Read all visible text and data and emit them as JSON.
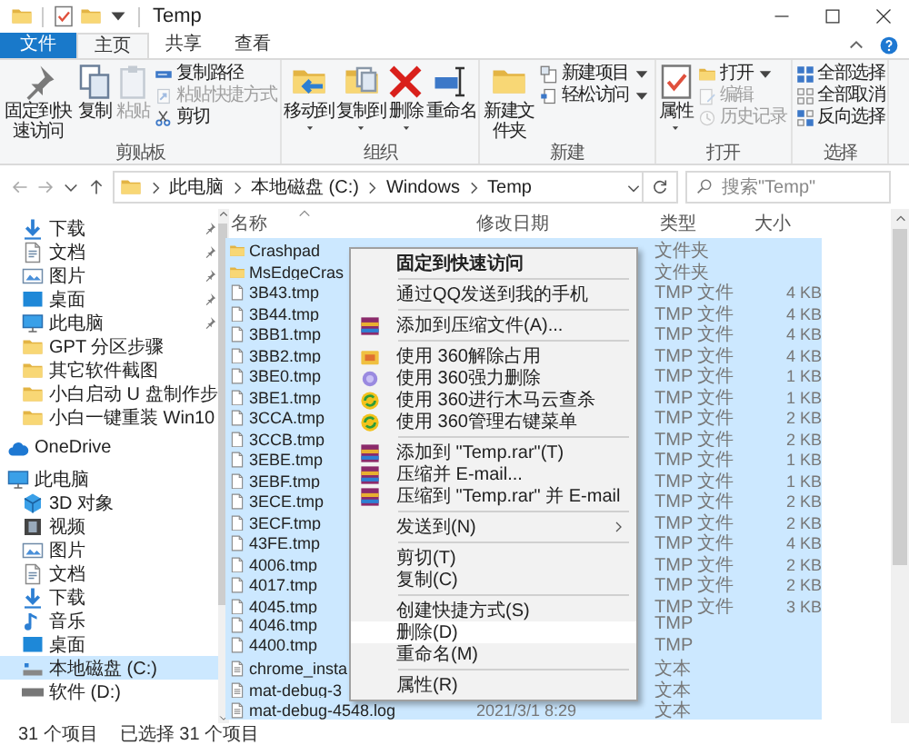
{
  "window": {
    "title": "Temp"
  },
  "ribbon_tabs": [
    {
      "label": "文件",
      "kind": "file",
      "selected": false
    },
    {
      "label": "主页",
      "kind": "tab",
      "selected": true
    },
    {
      "label": "共享",
      "kind": "tab",
      "selected": false
    },
    {
      "label": "查看",
      "kind": "tab",
      "selected": false
    }
  ],
  "ribbon": {
    "groups": [
      {
        "label": "剪贴板",
        "buttons": [
          {
            "label": "固定到快速访问",
            "kind": "large",
            "disabled": false
          },
          {
            "label": "复制",
            "kind": "large",
            "disabled": false
          },
          {
            "label": "粘贴",
            "kind": "large",
            "disabled": true
          },
          {
            "label": "复制路径",
            "kind": "small",
            "disabled": false
          },
          {
            "label": "粘贴快捷方式",
            "kind": "small",
            "disabled": true
          },
          {
            "label": "剪切",
            "kind": "small",
            "disabled": false
          }
        ]
      },
      {
        "label": "组织",
        "buttons": [
          {
            "label": "移动到",
            "kind": "large",
            "dropdown": true,
            "disabled": false
          },
          {
            "label": "复制到",
            "kind": "large",
            "dropdown": true,
            "disabled": false
          },
          {
            "label": "删除",
            "kind": "large",
            "dropdown": true,
            "disabled": false
          },
          {
            "label": "重命名",
            "kind": "large",
            "disabled": false
          }
        ]
      },
      {
        "label": "新建",
        "buttons": [
          {
            "label": "新建文件夹",
            "kind": "large",
            "disabled": false
          },
          {
            "label": "新建项目",
            "kind": "small",
            "dropdown": true,
            "disabled": false
          },
          {
            "label": "轻松访问",
            "kind": "small",
            "dropdown": true,
            "disabled": false
          }
        ]
      },
      {
        "label": "打开",
        "buttons": [
          {
            "label": "属性",
            "kind": "large",
            "dropdown": true,
            "disabled": false
          },
          {
            "label": "打开",
            "kind": "small",
            "dropdown": true,
            "disabled": false
          },
          {
            "label": "编辑",
            "kind": "small",
            "disabled": true
          },
          {
            "label": "历史记录",
            "kind": "small",
            "disabled": true
          }
        ]
      },
      {
        "label": "选择",
        "buttons": [
          {
            "label": "全部选择",
            "kind": "small",
            "disabled": false
          },
          {
            "label": "全部取消",
            "kind": "small",
            "disabled": false
          },
          {
            "label": "反向选择",
            "kind": "small",
            "disabled": false
          }
        ]
      }
    ]
  },
  "address": {
    "path": [
      "此电脑",
      "本地磁盘 (C:)",
      "Windows",
      "Temp"
    ],
    "search_placeholder": "搜索\"Temp\""
  },
  "navigation": {
    "quick_access": [
      {
        "label": "下载",
        "pinned": true,
        "selected": false
      },
      {
        "label": "文档",
        "pinned": true,
        "selected": false
      },
      {
        "label": "图片",
        "pinned": true,
        "selected": false
      },
      {
        "label": "桌面",
        "pinned": true,
        "selected": false
      },
      {
        "label": "此电脑",
        "pinned": true,
        "selected": false
      },
      {
        "label": "GPT 分区步骤",
        "pinned": false,
        "selected": false
      },
      {
        "label": "其它软件截图",
        "pinned": false,
        "selected": false
      },
      {
        "label": "小白启动 U 盘制作步",
        "pinned": false,
        "selected": false
      },
      {
        "label": "小白一键重装 Win10",
        "pinned": false,
        "selected": false
      }
    ],
    "onedrive": {
      "label": "OneDrive",
      "selected": false
    },
    "this_pc": {
      "label": "此电脑",
      "selected": false,
      "children": [
        {
          "label": "3D 对象",
          "selected": false
        },
        {
          "label": "视频",
          "selected": false
        },
        {
          "label": "图片",
          "selected": false
        },
        {
          "label": "文档",
          "selected": false
        },
        {
          "label": "下载",
          "selected": false
        },
        {
          "label": "音乐",
          "selected": false
        },
        {
          "label": "桌面",
          "selected": false
        },
        {
          "label": "本地磁盘 (C:)",
          "selected": true
        },
        {
          "label": "软件 (D:)",
          "selected": false
        }
      ]
    }
  },
  "table": {
    "columns": [
      {
        "label": "名称",
        "sorted": true
      },
      {
        "label": "修改日期",
        "sorted": false
      },
      {
        "label": "类型",
        "sorted": false
      },
      {
        "label": "大小",
        "sorted": false
      }
    ],
    "rows": [
      {
        "name": "Crashpad",
        "kind": "folder",
        "type": "文件夹",
        "selected": true
      },
      {
        "name": "MsEdgeCras",
        "kind": "folder",
        "type": "文件夹",
        "selected": true
      },
      {
        "name": "3B43.tmp",
        "kind": "file",
        "type": "TMP 文件",
        "size": "4 KB",
        "selected": true
      },
      {
        "name": "3B44.tmp",
        "kind": "file",
        "type": "TMP 文件",
        "size": "4 KB",
        "selected": true
      },
      {
        "name": "3BB1.tmp",
        "kind": "file",
        "type": "TMP 文件",
        "size": "4 KB",
        "selected": true
      },
      {
        "name": "3BB2.tmp",
        "kind": "file",
        "type": "TMP 文件",
        "size": "4 KB",
        "selected": true
      },
      {
        "name": "3BE0.tmp",
        "kind": "file",
        "type": "TMP 文件",
        "size": "1 KB",
        "selected": true
      },
      {
        "name": "3BE1.tmp",
        "kind": "file",
        "type": "TMP 文件",
        "size": "1 KB",
        "selected": true
      },
      {
        "name": "3CCA.tmp",
        "kind": "file",
        "type": "TMP 文件",
        "size": "2 KB",
        "selected": true
      },
      {
        "name": "3CCB.tmp",
        "kind": "file",
        "type": "TMP 文件",
        "size": "2 KB",
        "selected": true
      },
      {
        "name": "3EBE.tmp",
        "kind": "file",
        "type": "TMP 文件",
        "size": "1 KB",
        "selected": true
      },
      {
        "name": "3EBF.tmp",
        "kind": "file",
        "type": "TMP 文件",
        "size": "1 KB",
        "selected": true
      },
      {
        "name": "3ECE.tmp",
        "kind": "file",
        "type": "TMP 文件",
        "size": "2 KB",
        "selected": true
      },
      {
        "name": "3ECF.tmp",
        "kind": "file",
        "type": "TMP 文件",
        "size": "2 KB",
        "selected": true
      },
      {
        "name": "43FE.tmp",
        "kind": "file",
        "type": "TMP 文件",
        "size": "4 KB",
        "selected": true
      },
      {
        "name": "4006.tmp",
        "kind": "file",
        "type": "TMP 文件",
        "size": "2 KB",
        "selected": true
      },
      {
        "name": "4017.tmp",
        "kind": "file",
        "type": "TMP 文件",
        "size": "2 KB",
        "selected": true
      },
      {
        "name": "4045.tmp",
        "kind": "file",
        "type": "TMP 文件",
        "size": "3 KB",
        "selected": true
      },
      {
        "name": "4046.tmp",
        "kind": "file",
        "type": "TMP",
        "selected": true
      },
      {
        "name": "4400.tmp",
        "kind": "file",
        "type": "TMP",
        "selected": true
      },
      {
        "name": "chrome_insta",
        "kind": "text",
        "type": "文本",
        "selected": true
      },
      {
        "name": "mat-debug-3",
        "kind": "text",
        "type": "文本",
        "selected": true
      },
      {
        "name": "mat-debug-4548.log",
        "kind": "text",
        "date": "2021/3/1 8:29",
        "type": "文本",
        "selected": true
      }
    ]
  },
  "context_menu": {
    "sections": [
      [
        {
          "label": "固定到快速访问",
          "kind": "default",
          "highlighted": false
        }
      ],
      [
        {
          "label": "通过QQ发送到我的手机",
          "kind": "item",
          "highlighted": false
        }
      ],
      [
        {
          "label": "添加到压缩文件(A)...",
          "kind": "item",
          "highlighted": false
        }
      ],
      [
        {
          "label": "使用 360解除占用",
          "kind": "item",
          "highlighted": false
        },
        {
          "label": "使用 360强力删除",
          "kind": "item",
          "highlighted": false
        },
        {
          "label": "使用 360进行木马云查杀",
          "kind": "item",
          "highlighted": false
        },
        {
          "label": "使用 360管理右键菜单",
          "kind": "item",
          "highlighted": false
        }
      ],
      [
        {
          "label": "添加到 \"Temp.rar\"(T)",
          "kind": "item",
          "highlighted": false
        },
        {
          "label": "压缩并 E-mail...",
          "kind": "item",
          "highlighted": false
        },
        {
          "label": "压缩到 \"Temp.rar\" 并 E-mail",
          "kind": "item",
          "highlighted": false
        }
      ],
      [
        {
          "label": "发送到(N)",
          "kind": "submenu",
          "highlighted": false
        }
      ],
      [
        {
          "label": "剪切(T)",
          "kind": "item",
          "highlighted": false
        },
        {
          "label": "复制(C)",
          "kind": "item",
          "highlighted": false
        }
      ],
      [
        {
          "label": "创建快捷方式(S)",
          "kind": "item",
          "highlighted": false
        },
        {
          "label": "删除(D)",
          "kind": "item",
          "highlighted": true
        },
        {
          "label": "重命名(M)",
          "kind": "item",
          "highlighted": false
        }
      ],
      [
        {
          "label": "属性(R)",
          "kind": "item",
          "highlighted": false
        }
      ]
    ]
  },
  "status_bar": {
    "item_count": "31 个项目",
    "selection": "已选择 31 个项目"
  }
}
